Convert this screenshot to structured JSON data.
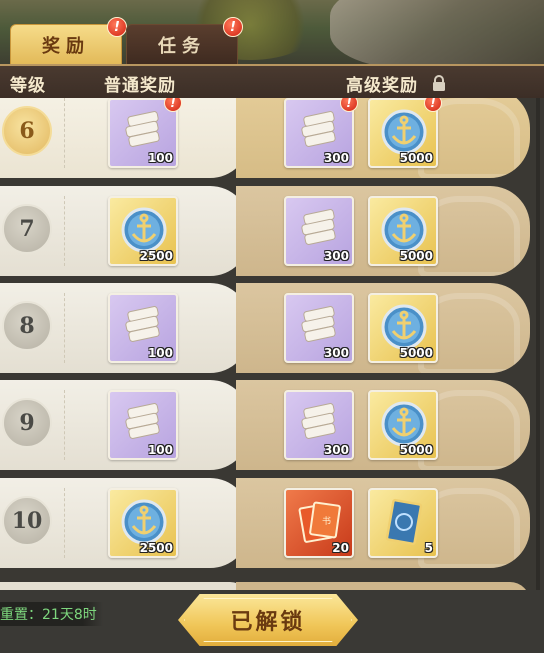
{
  "tabs": [
    {
      "label": "奖励",
      "alert": "!"
    },
    {
      "label": "任务",
      "alert": "!"
    }
  ],
  "header": {
    "level": "等级",
    "normal": "普通奖励",
    "premium": "高级奖励"
  },
  "rows": [
    {
      "level": "6",
      "normal": {
        "icon": "scroll-icon",
        "qty": "100",
        "alert": "!"
      },
      "premium": [
        {
          "icon": "scroll-icon",
          "qty": "300",
          "alert": "!"
        },
        {
          "icon": "anchor-coin-icon",
          "qty": "5000",
          "alert": "!"
        }
      ]
    },
    {
      "level": "7",
      "normal": {
        "icon": "anchor-coin-icon",
        "qty": "2500"
      },
      "premium": [
        {
          "icon": "scroll-icon",
          "qty": "300"
        },
        {
          "icon": "anchor-coin-icon",
          "qty": "5000"
        }
      ]
    },
    {
      "level": "8",
      "normal": {
        "icon": "scroll-icon",
        "qty": "100"
      },
      "premium": [
        {
          "icon": "scroll-icon",
          "qty": "300"
        },
        {
          "icon": "anchor-coin-icon",
          "qty": "5000"
        }
      ]
    },
    {
      "level": "9",
      "normal": {
        "icon": "scroll-icon",
        "qty": "100"
      },
      "premium": [
        {
          "icon": "scroll-icon",
          "qty": "300"
        },
        {
          "icon": "anchor-coin-icon",
          "qty": "5000"
        }
      ]
    },
    {
      "level": "10",
      "normal": {
        "icon": "anchor-coin-icon",
        "qty": "2500"
      },
      "premium": [
        {
          "icon": "red-book-icon",
          "qty": "20"
        },
        {
          "icon": "blue-card-icon",
          "qty": "5"
        }
      ]
    }
  ],
  "footer": {
    "reset": "重置：21天8时",
    "unlock_button": "已解锁"
  },
  "colors": {
    "reset_text": "#7ed87e",
    "alert": "#d02010",
    "gold": "#f0c658"
  }
}
